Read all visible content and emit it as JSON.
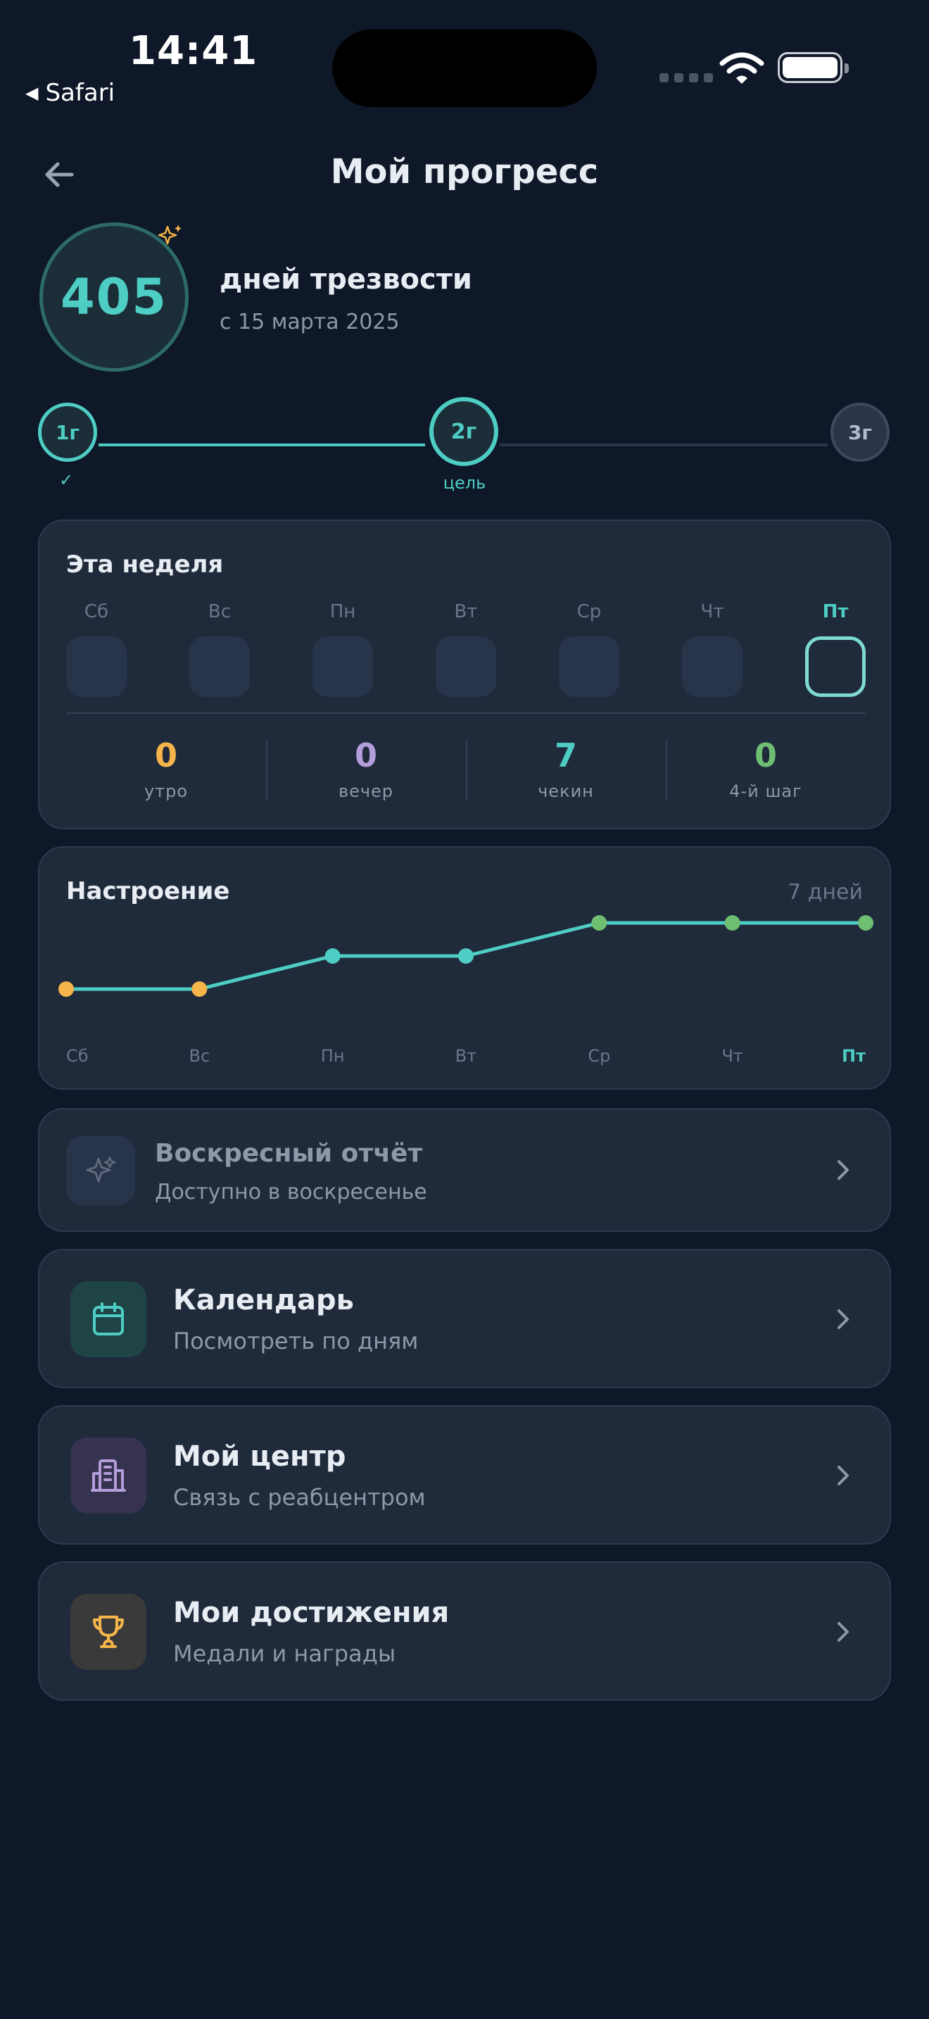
{
  "status_bar": {
    "time": "14:41",
    "back_app": "Safari"
  },
  "header": {
    "title": "Мой прогресс"
  },
  "counter": {
    "days": "405",
    "label": "дней трезвости",
    "since": "с 15 марта 2025"
  },
  "milestones": [
    {
      "label": "1г",
      "state": "done",
      "note": "✓"
    },
    {
      "label": "2г",
      "state": "goal",
      "note": "цель"
    },
    {
      "label": "3г",
      "state": "future",
      "note": ""
    }
  ],
  "week": {
    "title": "Эта неделя",
    "days": [
      "Сб",
      "Вс",
      "Пн",
      "Вт",
      "Ср",
      "Чт",
      "Пт"
    ],
    "active_day": "Пт",
    "stats": [
      {
        "value": "0",
        "label": "утро",
        "color": "#f5b54a"
      },
      {
        "value": "0",
        "label": "вечер",
        "color": "#b39ddb"
      },
      {
        "value": "7",
        "label": "чекин",
        "color": "#4ecdc4"
      },
      {
        "value": "0",
        "label": "4-й шаг",
        "color": "#6fbf73"
      }
    ]
  },
  "mood": {
    "title": "Настроение",
    "range": "7 дней"
  },
  "chart_data": {
    "type": "line",
    "categories": [
      "Сб",
      "Вс",
      "Пн",
      "Вт",
      "Ср",
      "Чт",
      "Пт"
    ],
    "values": [
      1,
      1,
      2,
      2,
      3,
      3,
      3
    ],
    "point_colors": [
      "#f5b54a",
      "#f5b54a",
      "#4ecdc4",
      "#4ecdc4",
      "#6fbf73",
      "#6fbf73",
      "#6fbf73"
    ],
    "line_color": "#4ecdc4",
    "ylim": [
      0,
      4
    ],
    "highlight_category": "Пт",
    "grid": false
  },
  "nav": [
    {
      "title": "Воскресный отчёт",
      "subtitle": "Доступно в воскресенье",
      "icon": "sparkle-icon",
      "disabled": true
    },
    {
      "title": "Календарь",
      "subtitle": "Посмотреть по дням",
      "icon": "calendar-icon",
      "disabled": false
    },
    {
      "title": "Мой центр",
      "subtitle": "Связь с реабцентром",
      "icon": "building-icon",
      "disabled": false
    },
    {
      "title": "Мои достижения",
      "subtitle": "Медали и награды",
      "icon": "trophy-icon",
      "disabled": false
    }
  ],
  "colors": {
    "accent": "#4ecdc4",
    "background": "#0f1828",
    "card": "#1f2a3b",
    "orange": "#f5b54a",
    "purple": "#b39ddb",
    "green": "#6fbf73"
  }
}
